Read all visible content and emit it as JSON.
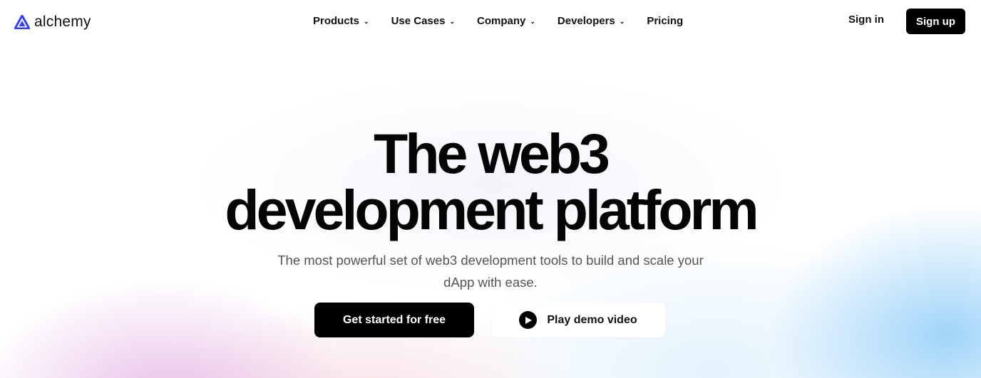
{
  "brand": {
    "name": "alchemy",
    "logo_icon": "alchemy-triangle-icon",
    "accent_color": "#363FF9"
  },
  "nav": {
    "items": [
      {
        "label": "Products",
        "has_dropdown": true
      },
      {
        "label": "Use Cases",
        "has_dropdown": true
      },
      {
        "label": "Company",
        "has_dropdown": true
      },
      {
        "label": "Developers",
        "has_dropdown": true
      },
      {
        "label": "Pricing",
        "has_dropdown": false
      }
    ],
    "chevron": "⌄"
  },
  "auth": {
    "sign_in_label": "Sign in",
    "sign_up_label": "Sign up"
  },
  "hero": {
    "headline_line1": "The web3",
    "headline_line2": "development platform",
    "subtitle": "The most powerful set of web3 development tools to build and scale your dApp with ease.",
    "primary_cta": "Get started for free",
    "secondary_cta": "Play demo video",
    "secondary_cta_icon": "play-icon"
  },
  "colors": {
    "primary_button": "#000000",
    "primary_button_text": "#FFFFFF",
    "secondary_button": "#FFFFFF",
    "subtitle_text": "#555555"
  }
}
